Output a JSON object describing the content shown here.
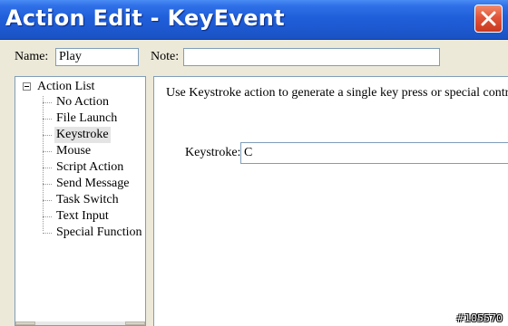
{
  "window": {
    "title": "Action Edit - KeyEvent"
  },
  "form": {
    "name_label": "Name:",
    "name_value": "Play",
    "note_label": "Note:",
    "note_value": ""
  },
  "tree": {
    "root_label": "Action List",
    "items": [
      {
        "label": "No Action"
      },
      {
        "label": "File Launch"
      },
      {
        "label": "Keystroke",
        "selected": true
      },
      {
        "label": "Mouse"
      },
      {
        "label": "Script Action"
      },
      {
        "label": "Send Message"
      },
      {
        "label": "Task Switch"
      },
      {
        "label": "Text Input"
      },
      {
        "label": "Special Function"
      }
    ]
  },
  "panel": {
    "description": "Use Keystroke action to generate a single key press or special control key.",
    "keystroke_label": "Keystroke:",
    "keystroke_value": "C"
  },
  "watermark": "#105570",
  "colors": {
    "titlebar": "#1f5fd9",
    "close_button": "#e2553a",
    "dialog_bg": "#ece9d8",
    "field_border": "#7f9db9",
    "selected_item_bg": "#e4e4e4"
  }
}
